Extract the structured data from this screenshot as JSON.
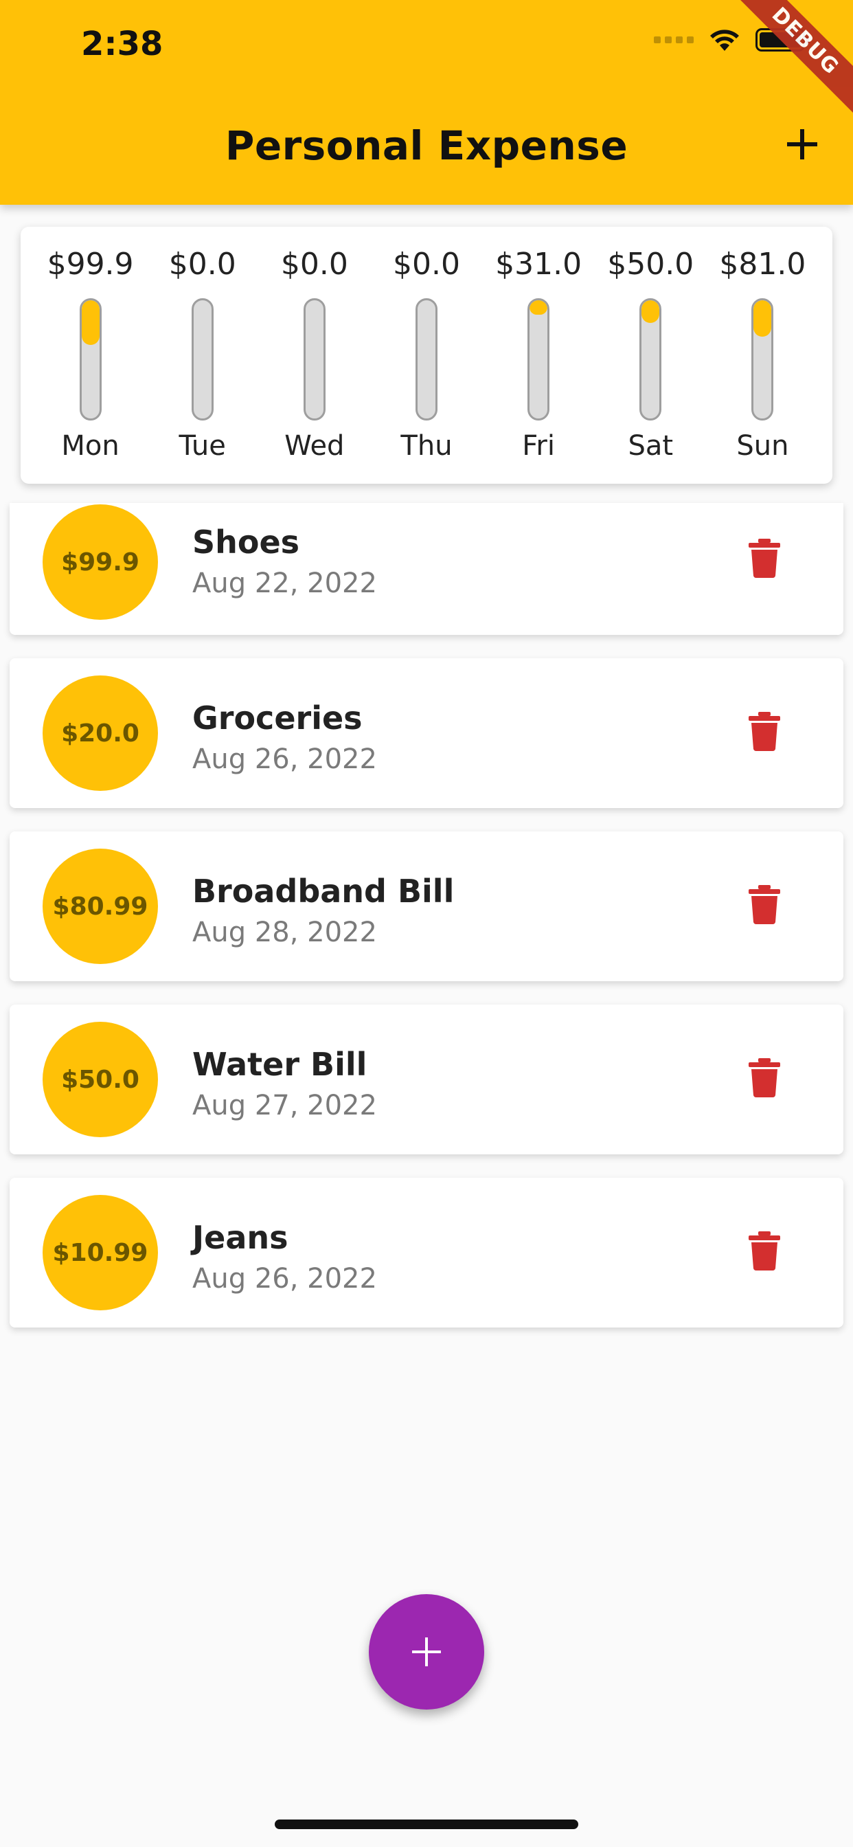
{
  "status_bar": {
    "time": "2:38"
  },
  "debug_banner": "DEBUG",
  "app_bar": {
    "title": "Personal Expense",
    "add_icon": "plus-icon"
  },
  "chart": {
    "bars": [
      {
        "day": "Mon",
        "amount": "$99.9",
        "fill_fraction": 0.38
      },
      {
        "day": "Tue",
        "amount": "$0.0",
        "fill_fraction": 0
      },
      {
        "day": "Wed",
        "amount": "$0.0",
        "fill_fraction": 0
      },
      {
        "day": "Thu",
        "amount": "$0.0",
        "fill_fraction": 0
      },
      {
        "day": "Fri",
        "amount": "$31.0",
        "fill_fraction": 0.12
      },
      {
        "day": "Sat",
        "amount": "$50.0",
        "fill_fraction": 0.19
      },
      {
        "day": "Sun",
        "amount": "$81.0",
        "fill_fraction": 0.31
      }
    ],
    "accent": "#ffc107"
  },
  "transactions": [
    {
      "amount": "$99.9",
      "title": "Shoes",
      "date": "Aug 22, 2022"
    },
    {
      "amount": "$20.0",
      "title": "Groceries",
      "date": "Aug 26, 2022"
    },
    {
      "amount": "$80.99",
      "title": "Broadband Bill",
      "date": "Aug 28, 2022"
    },
    {
      "amount": "$50.0",
      "title": "Water Bill",
      "date": "Aug 27, 2022"
    },
    {
      "amount": "$10.99",
      "title": "Jeans",
      "date": "Aug 26, 2022"
    }
  ],
  "fab": {
    "icon": "plus-icon",
    "color": "#9c27b0"
  },
  "colors": {
    "primary": "#ffc107",
    "delete": "#d32f2f",
    "background": "#fafafa"
  }
}
